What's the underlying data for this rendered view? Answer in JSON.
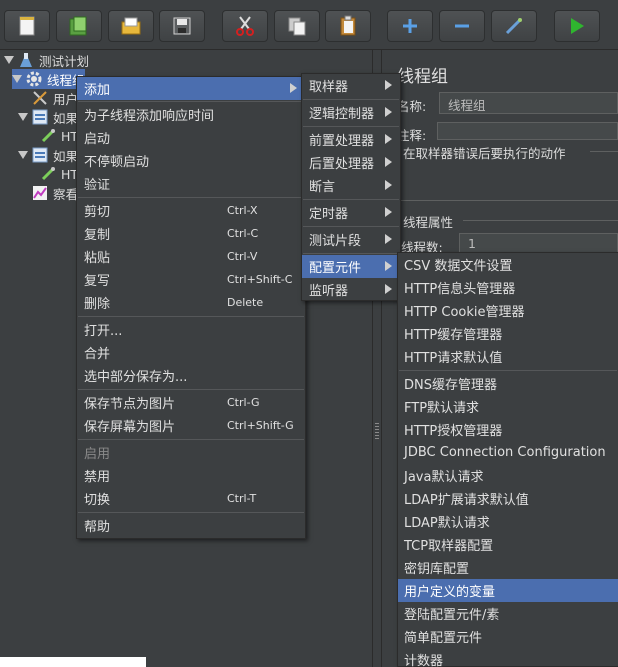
{
  "toolbar": {
    "buttons": [
      "new-icon",
      "templates-icon",
      "open-icon",
      "save-icon",
      "cut-icon",
      "copy-icon",
      "paste-icon",
      "expand-icon",
      "collapse-icon",
      "toggle-icon",
      "start-icon"
    ]
  },
  "tree": {
    "root": "测试计划",
    "thread_group": "线程组",
    "child1": "用户",
    "if1": "如果",
    "http1": "HT",
    "if2": "如果",
    "http2": "HT",
    "listener": "察看"
  },
  "panel": {
    "title": "线程组",
    "name_label": "名称:",
    "name_value": "线程组",
    "comment_label": "注释:",
    "error_action_label": "在取样器错误后要执行的动作",
    "thread_props_label": "线程属性",
    "threads_label": "线程数:",
    "threads_value": "1"
  },
  "menu": {
    "items": [
      {
        "label": "添加",
        "submenu": true
      },
      {
        "label": "为子线程添加响应时间"
      },
      {
        "label": "启动"
      },
      {
        "label": "不停顿启动"
      },
      {
        "label": "验证"
      },
      {
        "label": "剪切",
        "shortcut": "Ctrl-X"
      },
      {
        "label": "复制",
        "shortcut": "Ctrl-C"
      },
      {
        "label": "粘贴",
        "shortcut": "Ctrl-V"
      },
      {
        "label": "复写",
        "shortcut": "Ctrl+Shift-C"
      },
      {
        "label": "删除",
        "shortcut": "Delete"
      },
      {
        "label": "打开..."
      },
      {
        "label": "合并"
      },
      {
        "label": "选中部分保存为..."
      },
      {
        "label": "保存节点为图片",
        "shortcut": "Ctrl-G"
      },
      {
        "label": "保存屏幕为图片",
        "shortcut": "Ctrl+Shift-G"
      },
      {
        "label": "启用"
      },
      {
        "label": "禁用"
      },
      {
        "label": "切换",
        "shortcut": "Ctrl-T"
      },
      {
        "label": "帮助"
      }
    ]
  },
  "submenu": {
    "items": [
      "取样器",
      "逻辑控制器",
      "前置处理器",
      "后置处理器",
      "断言",
      "定时器",
      "测试片段",
      "配置元件",
      "监听器"
    ]
  },
  "config_menu": {
    "items": [
      "CSV 数据文件设置",
      "HTTP信息头管理器",
      "HTTP Cookie管理器",
      "HTTP缓存管理器",
      "HTTP请求默认值",
      "DNS缓存管理器",
      "FTP默认请求",
      "HTTP授权管理器",
      "JDBC Connection Configuration",
      "Java默认请求",
      "LDAP扩展请求默认值",
      "LDAP默认请求",
      "TCP取样器配置",
      "密钥库配置",
      "用户定义的变量",
      "登陆配置元件/素",
      "简单配置元件",
      "计数器"
    ]
  },
  "colors": {
    "selection": "#4b6eaf",
    "background": "#3c3f41"
  }
}
